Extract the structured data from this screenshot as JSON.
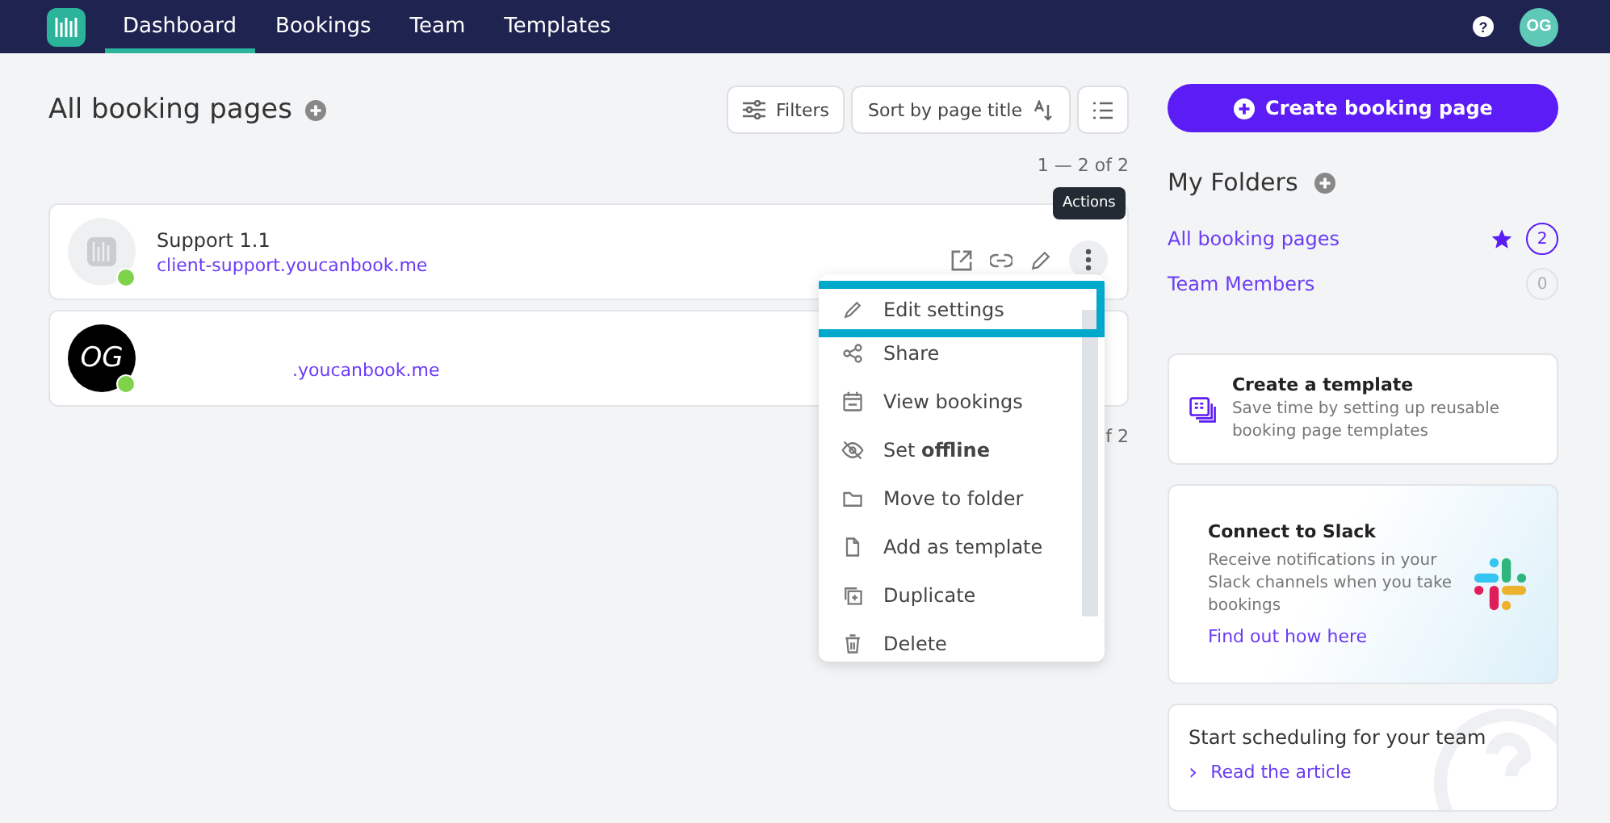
{
  "nav": {
    "tabs": [
      {
        "label": "Dashboard",
        "selected": true
      },
      {
        "label": "Bookings",
        "selected": false
      },
      {
        "label": "Team",
        "selected": false
      },
      {
        "label": "Templates",
        "selected": false
      }
    ],
    "help": "?",
    "avatar": "OG"
  },
  "main": {
    "title": "All booking pages",
    "filters": "Filters",
    "sort": "Sort by page title",
    "pagination_top": "1 — 2 of 2",
    "pagination_bottom": "f 2",
    "pages": [
      {
        "kind": "logo",
        "name": "Support 1.1",
        "url": "client-support.youcanbook.me",
        "online": true
      },
      {
        "kind": "initials",
        "initials": "OG",
        "url": ".youcanbook.me",
        "online": true
      }
    ],
    "tooltip": "Actions",
    "menu": [
      {
        "kind": "edit",
        "label": "Edit settings",
        "highlighted": true
      },
      {
        "kind": "share",
        "label": "Share",
        "highlighted": false
      },
      {
        "kind": "calendar",
        "label": "View bookings",
        "highlighted": false
      },
      {
        "kind": "offline",
        "label": "Set **offline**",
        "highlighted": false
      },
      {
        "kind": "folder",
        "label": "Move to folder",
        "highlighted": false
      },
      {
        "kind": "file",
        "label": "Add as template",
        "highlighted": false
      },
      {
        "kind": "duplicate",
        "label": "Duplicate",
        "highlighted": false
      },
      {
        "kind": "delete",
        "label": "Delete",
        "highlighted": false
      }
    ]
  },
  "side": {
    "create": "Create booking page",
    "folders_title": "My Folders",
    "folders": [
      {
        "label": "All booking pages",
        "count": "2",
        "selected": true
      },
      {
        "label": "Team Members",
        "count": "0",
        "selected": false
      }
    ],
    "template_card": {
      "title": "Create a template",
      "text": "Save time by setting up reusable booking page templates"
    },
    "slack_card": {
      "title": "Connect to Slack",
      "text": "Receive notifications in your Slack channels when you take bookings",
      "link": "Find out how here"
    },
    "team_card": {
      "title": "Start scheduling for your team",
      "chevron": "›",
      "link": "Read the article"
    }
  }
}
